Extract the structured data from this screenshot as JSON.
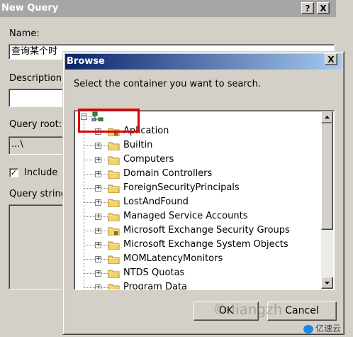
{
  "new_query": {
    "title": "New Query",
    "help_glyph": "?",
    "close_glyph": "X",
    "name_label": "Name:",
    "name_value": "查询某个时",
    "description_label": "Description:",
    "query_root_label": "Query root:",
    "query_root_value": "...\\",
    "include_label": "Include",
    "include_checked": true,
    "check_glyph": "✓",
    "query_string_label": "Query string:"
  },
  "browse": {
    "title": "Browse",
    "close_glyph": "X",
    "instruction": "Select the container you want to search.",
    "root_label": "",
    "items": [
      {
        "label": "Aplication",
        "icon": "special-folder-icon"
      },
      {
        "label": "Builtin",
        "icon": "folder-icon"
      },
      {
        "label": "Computers",
        "icon": "folder-icon"
      },
      {
        "label": "Domain Controllers",
        "icon": "folder-icon"
      },
      {
        "label": "ForeignSecurityPrincipals",
        "icon": "folder-icon"
      },
      {
        "label": "LostAndFound",
        "icon": "folder-icon"
      },
      {
        "label": "Managed Service Accounts",
        "icon": "folder-icon"
      },
      {
        "label": "Microsoft Exchange Security Groups",
        "icon": "special-folder-icon"
      },
      {
        "label": "Microsoft Exchange System Objects",
        "icon": "folder-icon"
      },
      {
        "label": "MOMLatencyMonitors",
        "icon": "folder-icon"
      },
      {
        "label": "NTDS Quotas",
        "icon": "folder-icon"
      },
      {
        "label": "Program Data",
        "icon": "folder-icon"
      }
    ],
    "expand_glyph": "+",
    "collapse_glyph": "−",
    "ok_label": "OK",
    "cancel_label": "Cancel"
  },
  "watermark": "© liangzh",
  "logo_text": "亿速云",
  "colors": {
    "highlight_box": "#e00000",
    "title_active_start": "#0a246a",
    "title_inactive": "#a6a6a6"
  }
}
